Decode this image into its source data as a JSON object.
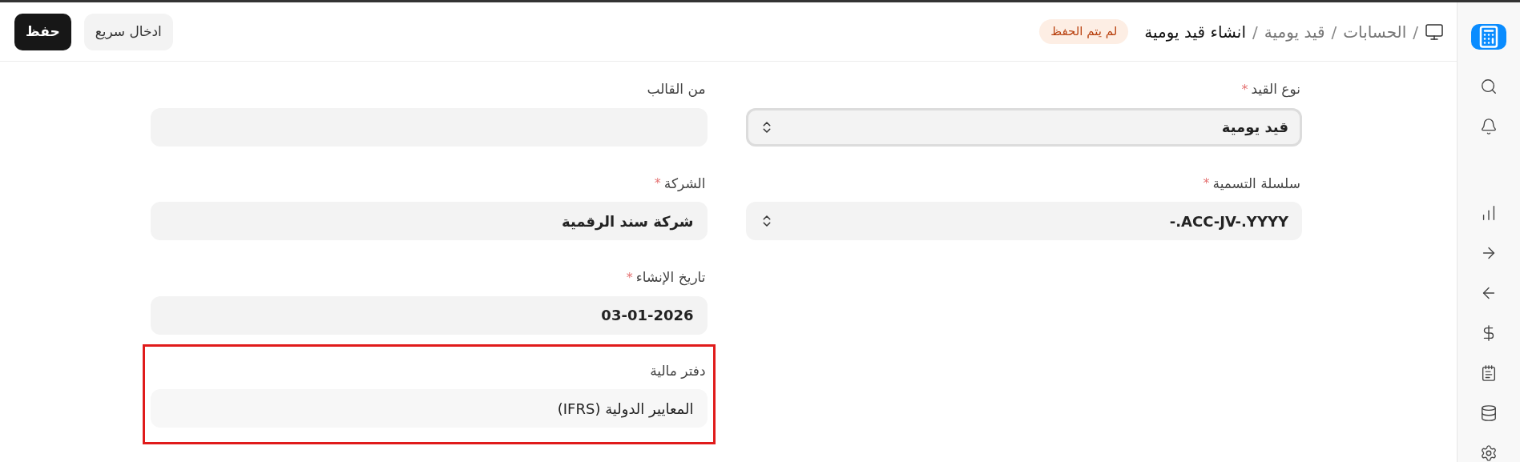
{
  "breadcrumb": [
    {
      "separator": "/",
      "label": "الحسابات",
      "current": false
    },
    {
      "separator": "/",
      "label": "قيد يومية",
      "current": false
    },
    {
      "separator": "/",
      "label": "انشاء قيد يومية",
      "current": true
    }
  ],
  "status_badge": "لم يتم الحفظ",
  "buttons": [
    {
      "label": "ادخال سريع",
      "kind": "secondary"
    },
    {
      "label": "حفظ",
      "kind": "primary"
    }
  ],
  "columns": [
    {
      "fields": [
        {
          "label": "نوع القيد",
          "required_mark": "*",
          "kind": "select",
          "value": "قيد يومية",
          "focused": true,
          "highlighted": false
        },
        {
          "label": "سلسلة التسمية",
          "required_mark": "*",
          "kind": "select",
          "value": "ACC-JV-.YYYY.-",
          "focused": false,
          "highlighted": false
        }
      ]
    },
    {
      "fields": [
        {
          "label": "من القالب",
          "kind": "text",
          "focused": false,
          "highlighted": false
        },
        {
          "label": "الشركة",
          "required_mark": "*",
          "kind": "text",
          "value": "شركة سند الرقمية",
          "focused": false,
          "highlighted": false
        },
        {
          "label": "تاريخ الإنشاء",
          "required_mark": "*",
          "kind": "text",
          "value": "03-01-2026",
          "focused": false,
          "highlighted": false
        },
        {
          "label": "دفتر مالية",
          "kind": "link",
          "value": "المعايير الدولية (IFRS)",
          "focused": false,
          "highlighted": true
        }
      ]
    }
  ]
}
